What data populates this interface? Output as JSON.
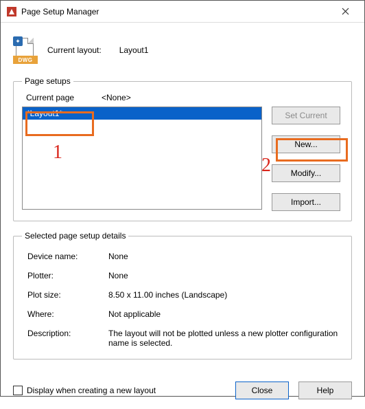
{
  "window": {
    "title": "Page Setup Manager"
  },
  "header": {
    "current_layout_label": "Current layout:",
    "current_layout_value": "Layout1",
    "dwg_badge": "DWG"
  },
  "page_setups": {
    "legend": "Page setups",
    "current_page_label": "Current page",
    "current_page_value": "<None>",
    "items": [
      "*Layout1*"
    ],
    "buttons": {
      "set_current": "Set Current",
      "new": "New...",
      "modify": "Modify...",
      "import": "Import..."
    }
  },
  "details": {
    "legend": "Selected page setup details",
    "device_name_label": "Device name:",
    "device_name_value": "None",
    "plotter_label": "Plotter:",
    "plotter_value": "None",
    "plot_size_label": "Plot size:",
    "plot_size_value": "8.50 x 11.00 inches (Landscape)",
    "where_label": "Where:",
    "where_value": "Not applicable",
    "description_label": "Description:",
    "description_value": "The layout will not be plotted unless a new plotter configuration name is selected."
  },
  "footer": {
    "display_on_new_layout": "Display when creating a new layout",
    "close": "Close",
    "help": "Help"
  },
  "annotations": {
    "n1": "1",
    "n2": "2"
  }
}
